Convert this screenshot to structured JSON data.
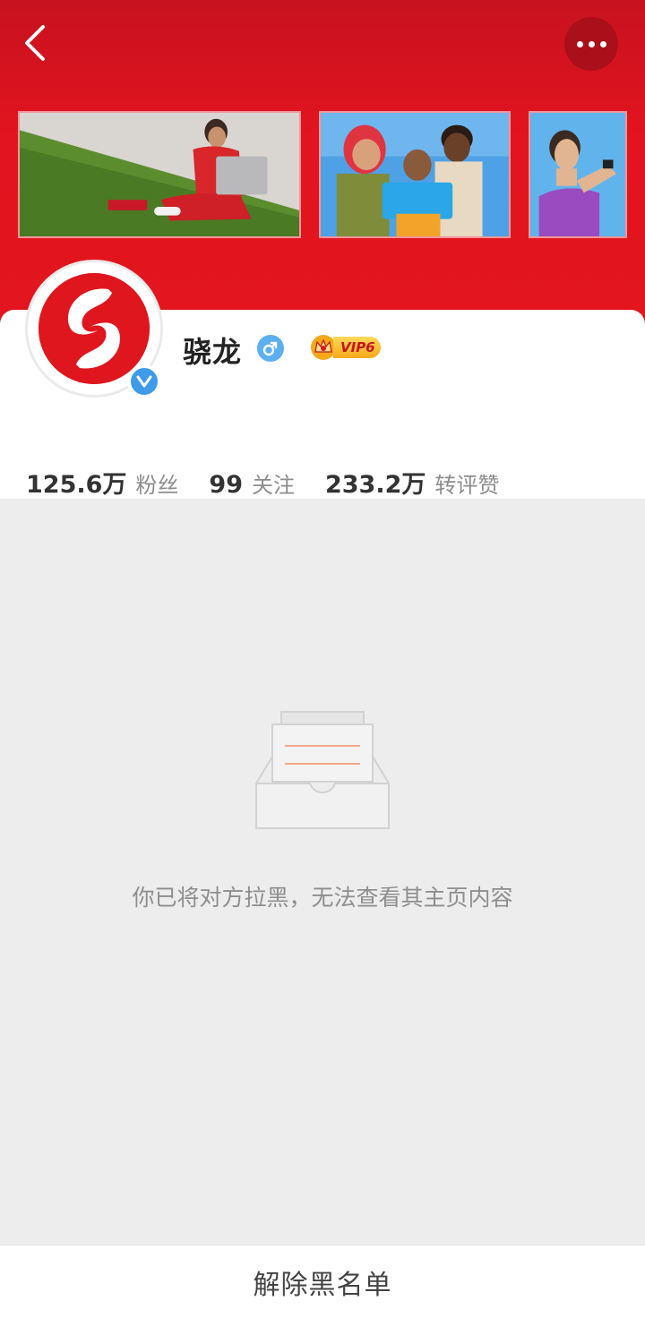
{
  "header": {
    "back_icon": "chevron-left-icon",
    "more_icon": "more-horizontal-icon",
    "accent_color": "#e3161f"
  },
  "banners": [
    {
      "subject": "woman-laptop-on-grass"
    },
    {
      "subject": "friends-looking-at-phone"
    },
    {
      "subject": "woman-with-earbuds-smartwatch"
    }
  ],
  "profile": {
    "name": "骁龙",
    "gender_symbol": "♂",
    "vip_label": "VIP6",
    "verified_icon": "verified-v-icon"
  },
  "stats": [
    {
      "value": "125.6万",
      "label": "粉丝"
    },
    {
      "value": "99",
      "label": "关注"
    },
    {
      "value": "233.2万",
      "label": "转评赞"
    }
  ],
  "empty_state": {
    "icon": "empty-inbox-icon",
    "message": "你已将对方拉黑，无法查看其主页内容"
  },
  "footer": {
    "unblock_label": "解除黑名单"
  }
}
